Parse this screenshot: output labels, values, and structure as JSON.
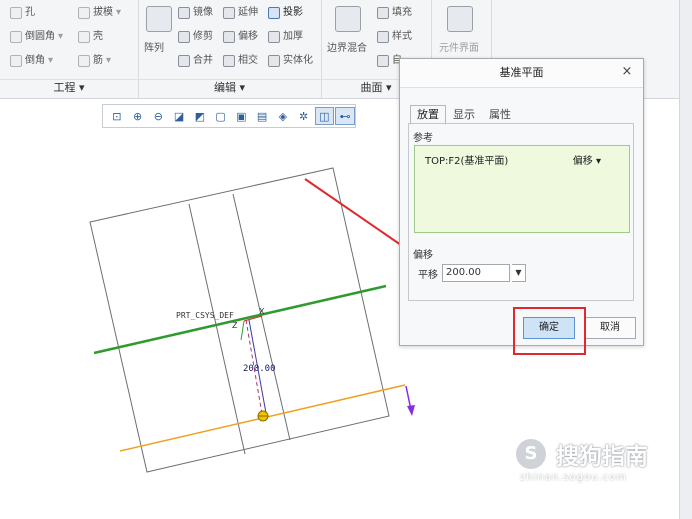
{
  "ribbon": {
    "groups": [
      {
        "label": "工程",
        "items": [
          "孔",
          "拔模",
          "倒圆角",
          "壳",
          "倒角",
          "筋"
        ]
      },
      {
        "label": "编辑",
        "items": [
          "阵列",
          "镜像",
          "延伸",
          "投影",
          "修剪",
          "偏移",
          "加厚",
          "合并",
          "相交",
          "实体化"
        ]
      },
      {
        "label": "曲面",
        "items": [
          "边界混合",
          "填充",
          "样式",
          "自"
        ]
      },
      {
        "label": "",
        "items": [
          "元件界面"
        ]
      }
    ]
  },
  "view_toolbar": {
    "buttons": [
      "refit-icon",
      "zoom-in-icon",
      "zoom-out-icon",
      "repaint-icon",
      "display-style-icon",
      "saved-views-icon",
      "view-orient-icon",
      "view-manager-icon",
      "datum-display-icon",
      "spin-center-icon",
      "annotation-icon",
      "csys-icon"
    ]
  },
  "model": {
    "csys_label": "PRT_CSYS_DEF",
    "dimension": "200.00",
    "axis_z": "Z",
    "axis_x": "X"
  },
  "dialog": {
    "title": "基准平面",
    "close": "×",
    "tabs": [
      "放置",
      "显示",
      "属性"
    ],
    "references_label": "参考",
    "reference_item": "TOP:F2(基准平面)",
    "reference_type": "偏移 ▾",
    "offset_label": "偏移",
    "translate_label": "平移",
    "translate_value": "200.00",
    "ok": "确定",
    "cancel": "取消"
  },
  "watermark": {
    "logo": "S",
    "brand": "搜狗指南",
    "url": "zhinan.sogou.com"
  },
  "colors": {
    "selected_plane": "#2f9a2f",
    "new_plane": "#f0a020",
    "arrow": "#e0282d",
    "dialog_accept": "#cfe3f7"
  }
}
